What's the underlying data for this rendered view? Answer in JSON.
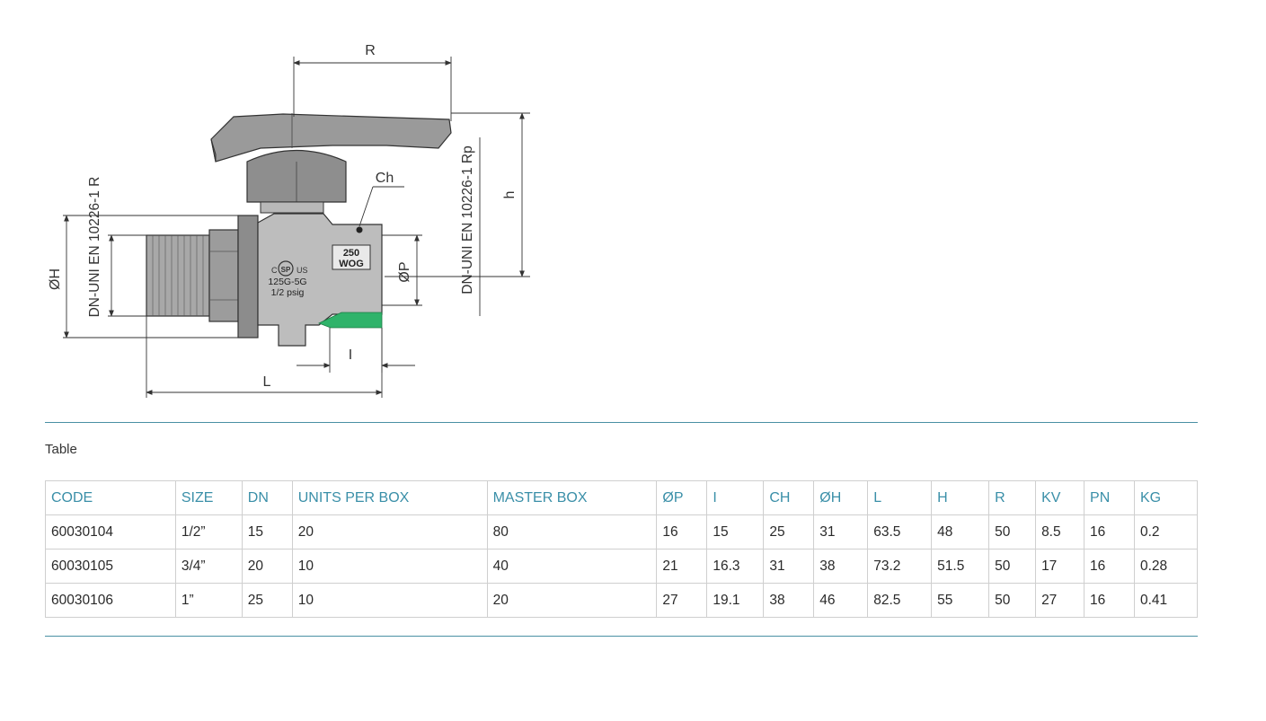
{
  "drawing": {
    "dimension_labels": {
      "R": "R",
      "Ch": "Ch",
      "h": "h",
      "OH": "ØH",
      "OP": "ØP",
      "L": "L",
      "I": "I",
      "thread_R": "DN-UNI EN 10226-1 R",
      "thread_Rp": "DN-UNI EN 10226-1 Rp"
    },
    "body_markings": {
      "rating_line1": "250",
      "rating_line2": "WOG",
      "csa_c": "C",
      "csa_us": "US",
      "csa_mark": "SP",
      "gas_rating": "125G-5G",
      "pressure": "1/2  psig"
    }
  },
  "table": {
    "caption": "Table",
    "columns": [
      "CODE",
      "SIZE",
      "DN",
      "UNITS PER BOX",
      "MASTER BOX",
      "ØP",
      "I",
      "CH",
      "ØH",
      "L",
      "H",
      "R",
      "KV",
      "PN",
      "KG"
    ],
    "rows": [
      [
        "60030104",
        "1/2”",
        "15",
        "20",
        "80",
        "16",
        "15",
        "25",
        "31",
        "63.5",
        "48",
        "50",
        "8.5",
        "16",
        "0.2"
      ],
      [
        "60030105",
        "3/4”",
        "20",
        "10",
        "40",
        "21",
        "16.3",
        "31",
        "38",
        "73.2",
        "51.5",
        "50",
        "17",
        "16",
        "0.28"
      ],
      [
        "60030106",
        "1”",
        "25",
        "10",
        "20",
        "27",
        "19.1",
        "38",
        "46",
        "82.5",
        "55",
        "50",
        "27",
        "16",
        "0.41"
      ]
    ]
  }
}
